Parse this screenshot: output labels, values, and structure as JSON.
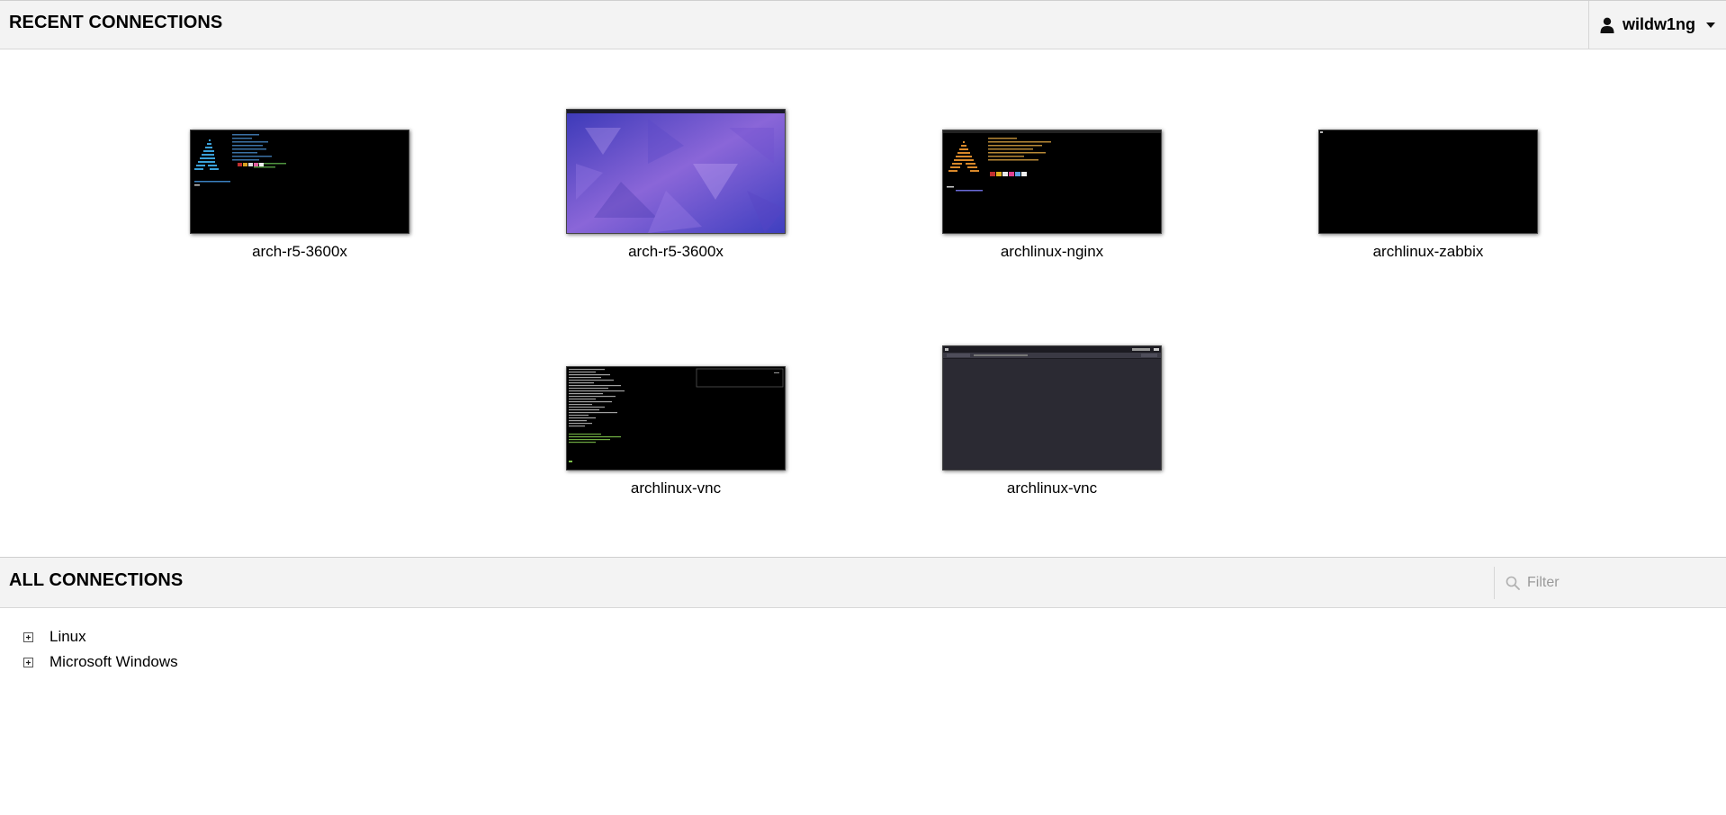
{
  "recent": {
    "title": "RECENT CONNECTIONS",
    "user": {
      "name": "wildw1ng",
      "icon": "user-icon"
    },
    "connections": [
      {
        "label": "arch-r5-3600x",
        "preview": "terminal-neofetch"
      },
      {
        "label": "arch-r5-3600x",
        "preview": "purple-desktop"
      },
      {
        "label": "archlinux-nginx",
        "preview": "terminal-neofetch-orange"
      },
      {
        "label": "archlinux-zabbix",
        "preview": "black-screen"
      },
      {
        "label": "archlinux-vnc",
        "preview": "terminal-log"
      },
      {
        "label": "archlinux-vnc",
        "preview": "dark-desktop"
      }
    ]
  },
  "all": {
    "title": "ALL CONNECTIONS",
    "filter": {
      "placeholder": "Filter",
      "value": ""
    },
    "groups": [
      {
        "label": "Linux",
        "expanded": false
      },
      {
        "label": "Microsoft Windows",
        "expanded": false
      }
    ]
  },
  "colors": {
    "header_bg": "#f3f3f3",
    "desktop_purple": "#6a4fd0",
    "dark_desktop": "#2b2a33"
  }
}
